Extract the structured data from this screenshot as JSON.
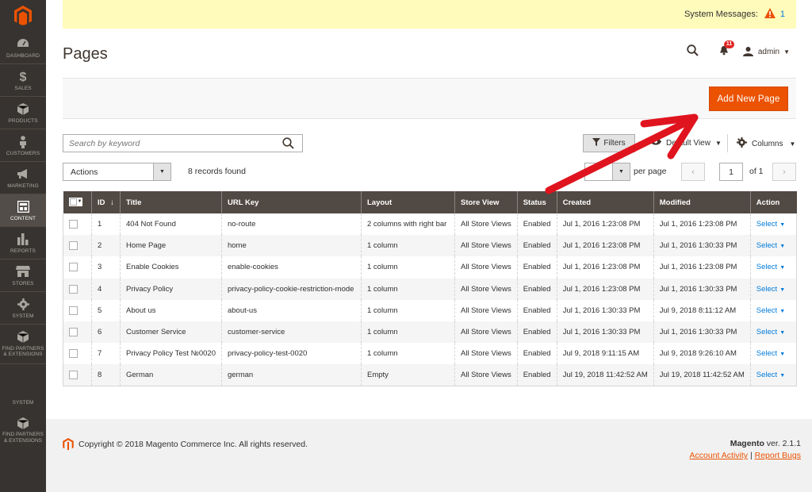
{
  "sidebar": {
    "items": [
      {
        "label": "DASHBOARD",
        "icon": "dashboard-icon"
      },
      {
        "label": "SALES",
        "icon": "dollar-icon"
      },
      {
        "label": "PRODUCTS",
        "icon": "box-icon"
      },
      {
        "label": "CUSTOMERS",
        "icon": "person-icon"
      },
      {
        "label": "MARKETING",
        "icon": "megaphone-icon"
      },
      {
        "label": "CONTENT",
        "icon": "layout-icon",
        "active": true
      },
      {
        "label": "REPORTS",
        "icon": "bar-chart-icon"
      },
      {
        "label": "STORES",
        "icon": "store-icon"
      },
      {
        "label": "SYSTEM",
        "icon": "gear-icon"
      },
      {
        "label1": "FIND PARTNERS",
        "label2": "& EXTENSIONS",
        "icon": "cube-icon"
      }
    ],
    "system_label": "SYSTEM",
    "bottom_label1": "FIND PARTNERS",
    "bottom_label2": "& EXTENSIONS"
  },
  "system_messages": {
    "label": "System Messages:",
    "count": "1"
  },
  "header": {
    "title": "Pages",
    "notifications_count": "11",
    "user": "admin"
  },
  "toolbar": {
    "add_button": "Add New Page"
  },
  "search": {
    "placeholder": "Search by keyword"
  },
  "filters": {
    "filters_label": "Filters",
    "view_label": "Default View",
    "columns_label": "Columns"
  },
  "mass_actions": {
    "label": "Actions",
    "records_found": "8 records found"
  },
  "pagination": {
    "per_page_label": "per page",
    "current_page": "1",
    "of_label": "of 1"
  },
  "table": {
    "columns": [
      "ID",
      "Title",
      "URL Key",
      "Layout",
      "Store View",
      "Status",
      "Created",
      "Modified",
      "Action"
    ],
    "sort_indicator": "↓",
    "rows": [
      {
        "id": "1",
        "title": "404 Not Found",
        "url": "no-route",
        "layout": "2 columns with right bar",
        "store": "All Store Views",
        "status": "Enabled",
        "created": "Jul 1, 2016 1:23:08 PM",
        "modified": "Jul 1, 2016 1:23:08 PM",
        "action": "Select"
      },
      {
        "id": "2",
        "title": "Home Page",
        "url": "home",
        "layout": "1 column",
        "store": "All Store Views",
        "status": "Enabled",
        "created": "Jul 1, 2016 1:23:08 PM",
        "modified": "Jul 1, 2016 1:30:33 PM",
        "action": "Select"
      },
      {
        "id": "3",
        "title": "Enable Cookies",
        "url": "enable-cookies",
        "layout": "1 column",
        "store": "All Store Views",
        "status": "Enabled",
        "created": "Jul 1, 2016 1:23:08 PM",
        "modified": "Jul 1, 2016 1:23:08 PM",
        "action": "Select"
      },
      {
        "id": "4",
        "title": "Privacy Policy",
        "url": "privacy-policy-cookie-restriction-mode",
        "layout": "1 column",
        "store": "All Store Views",
        "status": "Enabled",
        "created": "Jul 1, 2016 1:23:08 PM",
        "modified": "Jul 1, 2016 1:30:33 PM",
        "action": "Select"
      },
      {
        "id": "5",
        "title": "About us",
        "url": "about-us",
        "layout": "1 column",
        "store": "All Store Views",
        "status": "Enabled",
        "created": "Jul 1, 2016 1:30:33 PM",
        "modified": "Jul 9, 2018 8:11:12 AM",
        "action": "Select"
      },
      {
        "id": "6",
        "title": "Customer Service",
        "url": "customer-service",
        "layout": "1 column",
        "store": "All Store Views",
        "status": "Enabled",
        "created": "Jul 1, 2016 1:30:33 PM",
        "modified": "Jul 1, 2016 1:30:33 PM",
        "action": "Select"
      },
      {
        "id": "7",
        "title": "Privacy Policy Test №0020",
        "url": "privacy-policy-test-0020",
        "layout": "1 column",
        "store": "All Store Views",
        "status": "Enabled",
        "created": "Jul 9, 2018 9:11:15 AM",
        "modified": "Jul 9, 2018 9:26:10 AM",
        "action": "Select"
      },
      {
        "id": "8",
        "title": "German",
        "url": "german",
        "layout": "Empty",
        "store": "All Store Views",
        "status": "Enabled",
        "created": "Jul 19, 2018 11:42:52 AM",
        "modified": "Jul 19, 2018 11:42:52 AM",
        "action": "Select"
      }
    ]
  },
  "footer": {
    "copyright": "Copyright © 2018 Magento Commerce Inc. All rights reserved.",
    "brand": "Magento",
    "version": "ver. 2.1.1",
    "account_activity": "Account Activity",
    "separator": "|",
    "report_bugs": "Report Bugs"
  },
  "colors": {
    "sidebar_bg": "#373330",
    "accent_orange": "#eb5202",
    "header_row_bg": "#514943",
    "link_blue": "#007bdb",
    "annotation_red": "#e0141e",
    "message_bg": "#fffbbb"
  }
}
